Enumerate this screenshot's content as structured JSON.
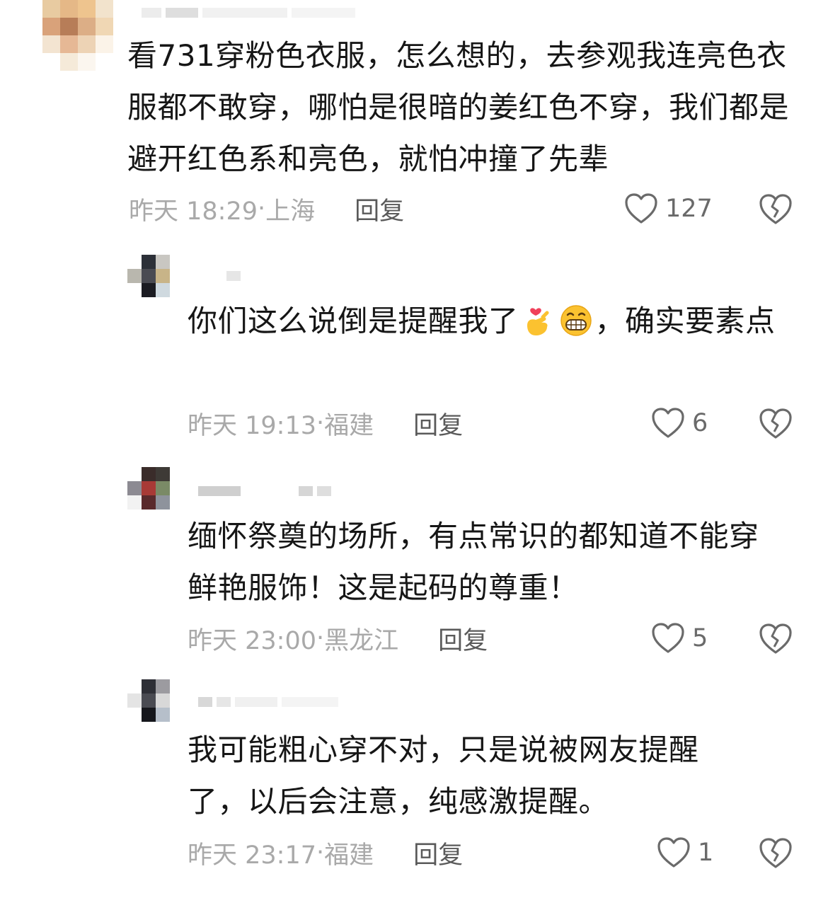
{
  "colors": {
    "text": "#161616",
    "meta": "#a9a9a9",
    "reply_button": "#5a5a5a",
    "icon": "#6a6a6a"
  },
  "comments": [
    {
      "text": "看731穿粉色衣服，怎么想的，去参观我连亮色衣服都不敢穿，哪怕是很暗的姜红色不穿，我们都是避开红色系和亮色，就怕冲撞了先辈",
      "time": "昨天 18:29",
      "location": "上海",
      "reply_label": "回复",
      "likes": "127",
      "like_icon": "heart-outline-icon",
      "dislike_icon": "broken-heart-icon"
    },
    {
      "text_before_emoji": "你们这么说倒是提醒我了",
      "emojis": [
        "finger-heart-emoji",
        "grinning-emoji"
      ],
      "text_after_emoji": "，确实要素点",
      "time": "昨天 19:13",
      "location": "福建",
      "reply_label": "回复",
      "likes": "6"
    },
    {
      "text": "缅怀祭奠的场所，有点常识的都知道不能穿鲜艳服饰！这是起码的尊重！",
      "time": "昨天 23:00",
      "location": "黑龙江",
      "reply_label": "回复",
      "likes": "5"
    },
    {
      "text": "我可能粗心穿不对，只是说被网友提醒了，以后会注意，纯感激提醒。",
      "time": "昨天 23:17",
      "location": "福建",
      "reply_label": "回复",
      "likes": "1"
    }
  ]
}
